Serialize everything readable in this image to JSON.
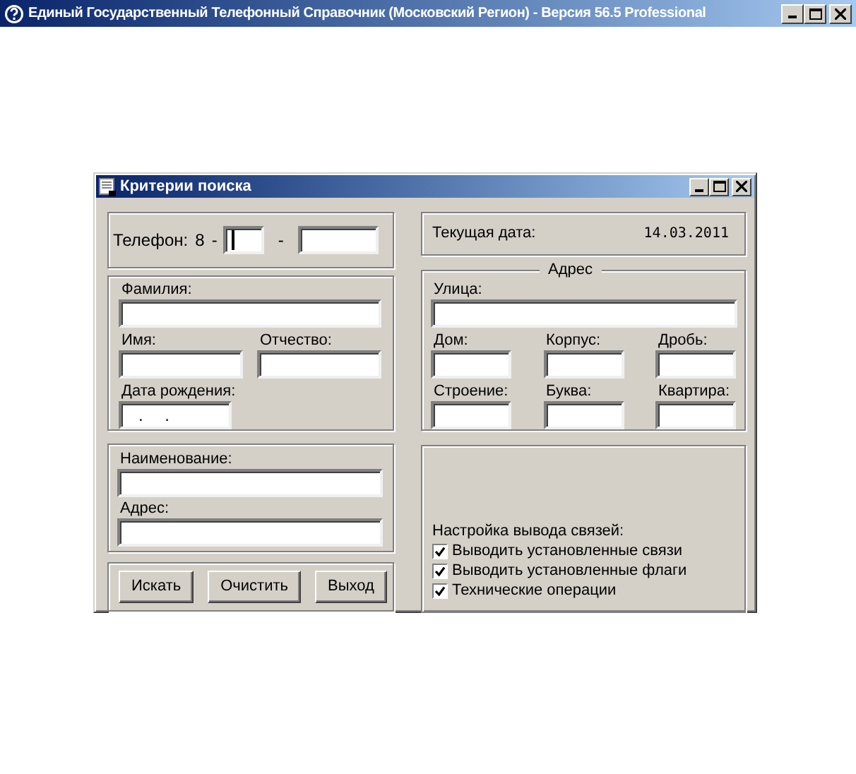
{
  "window": {
    "title": "Единый Государственный Телефонный Справочник (Московский Регион) - Версия 56.5 Professional"
  },
  "dialog": {
    "title": "Критерии поиска"
  },
  "phone": {
    "label": "Телефон:",
    "prefix": "8",
    "separator_1": "-",
    "separator_2": "-",
    "fields": [
      {
        "focused": true
      },
      {
        "focused": false
      }
    ]
  },
  "current_date": {
    "label": "Текущая дата:",
    "value": "14.03.2011"
  },
  "person": {
    "rows": [
      [
        {
          "label": "Фамилия:"
        }
      ],
      [
        {
          "label": "Имя:"
        },
        {
          "label": "Отчество:"
        }
      ],
      [
        {
          "label": "Дата рождения:",
          "value": ".  ."
        }
      ]
    ]
  },
  "address": {
    "legend": "Адрес",
    "street": {
      "label": "Улица:"
    },
    "rows": [
      [
        {
          "label": "Дом:"
        },
        {
          "label": "Корпус:"
        },
        {
          "label": "Дробь:"
        }
      ],
      [
        {
          "label": "Строение:"
        },
        {
          "label": "Буква:"
        },
        {
          "label": "Квартира:"
        }
      ]
    ]
  },
  "organization": {
    "fields": [
      {
        "label": "Наименование:"
      },
      {
        "label": "Адрес:"
      }
    ]
  },
  "buttons": [
    "Искать",
    "Очистить",
    "Выход"
  ],
  "output_settings": {
    "label": "Настройка вывода связей:",
    "options": [
      {
        "label": "Выводить установленные связи",
        "checked": true
      },
      {
        "label": "Выводить установленные флаги",
        "checked": true
      },
      {
        "label": "Технические операции",
        "checked": true
      }
    ]
  }
}
